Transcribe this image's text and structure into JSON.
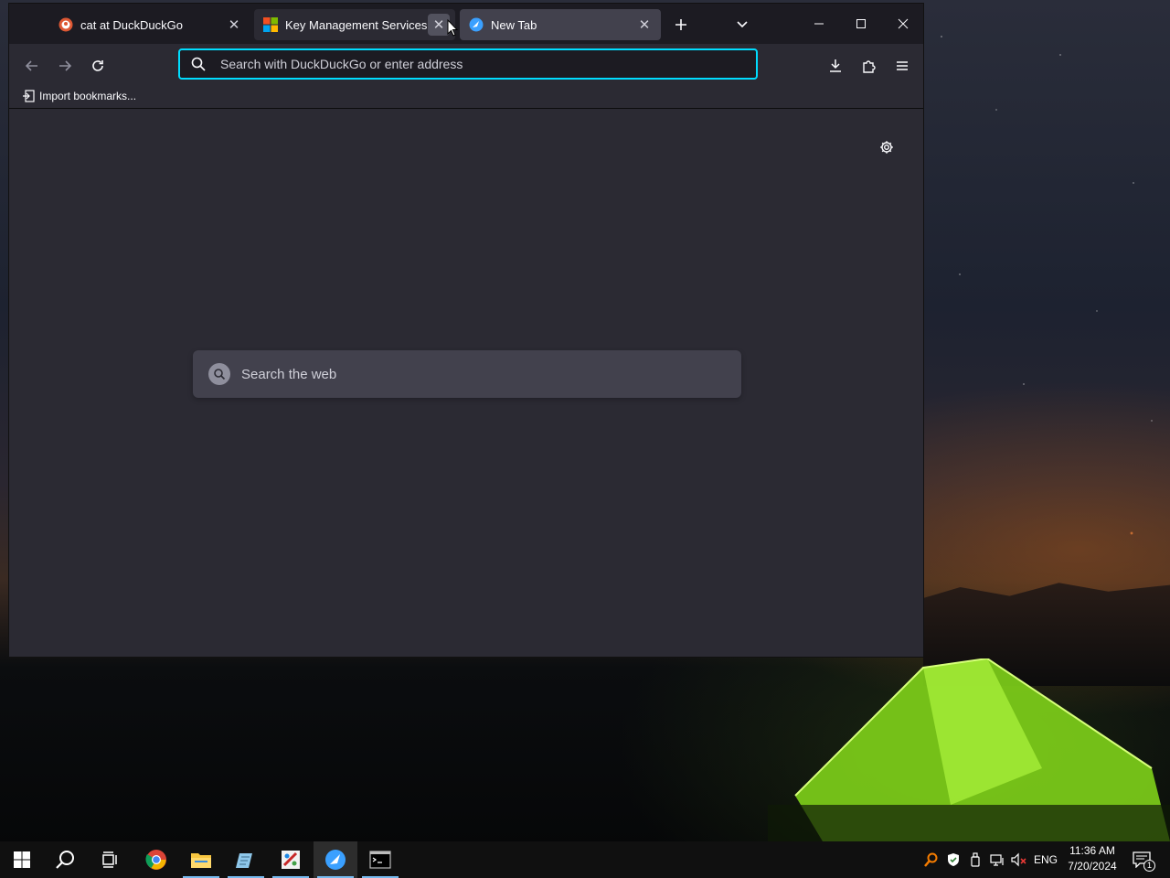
{
  "tabs": [
    {
      "label": "cat at DuckDuckGo",
      "favicon": "duckduckgo-icon",
      "active": false
    },
    {
      "label": "Key Management Services (KMS",
      "favicon": "microsoft-icon",
      "active": false
    },
    {
      "label": "New Tab",
      "favicon": "browser-icon",
      "active": true
    }
  ],
  "urlbar": {
    "placeholder": "Search with DuckDuckGo or enter address",
    "value": ""
  },
  "bookmarks_toolbar": {
    "import_label": "Import bookmarks..."
  },
  "newtab": {
    "search_placeholder": "Search the web"
  },
  "taskbar": {
    "apps": [
      "start-icon",
      "search-icon",
      "task-view-icon",
      "chrome-icon",
      "file-explorer-icon",
      "notepad-icon",
      "paint-icon",
      "browser-icon",
      "terminal-icon"
    ],
    "language": "ENG",
    "time": "11:36 AM",
    "date": "7/20/2024",
    "notification_count": "1"
  },
  "colors": {
    "accent": "#00ddff",
    "window_bg": "#2b2a33",
    "tabbar_bg": "#1c1b22",
    "taskbar_bg": "#101010"
  }
}
